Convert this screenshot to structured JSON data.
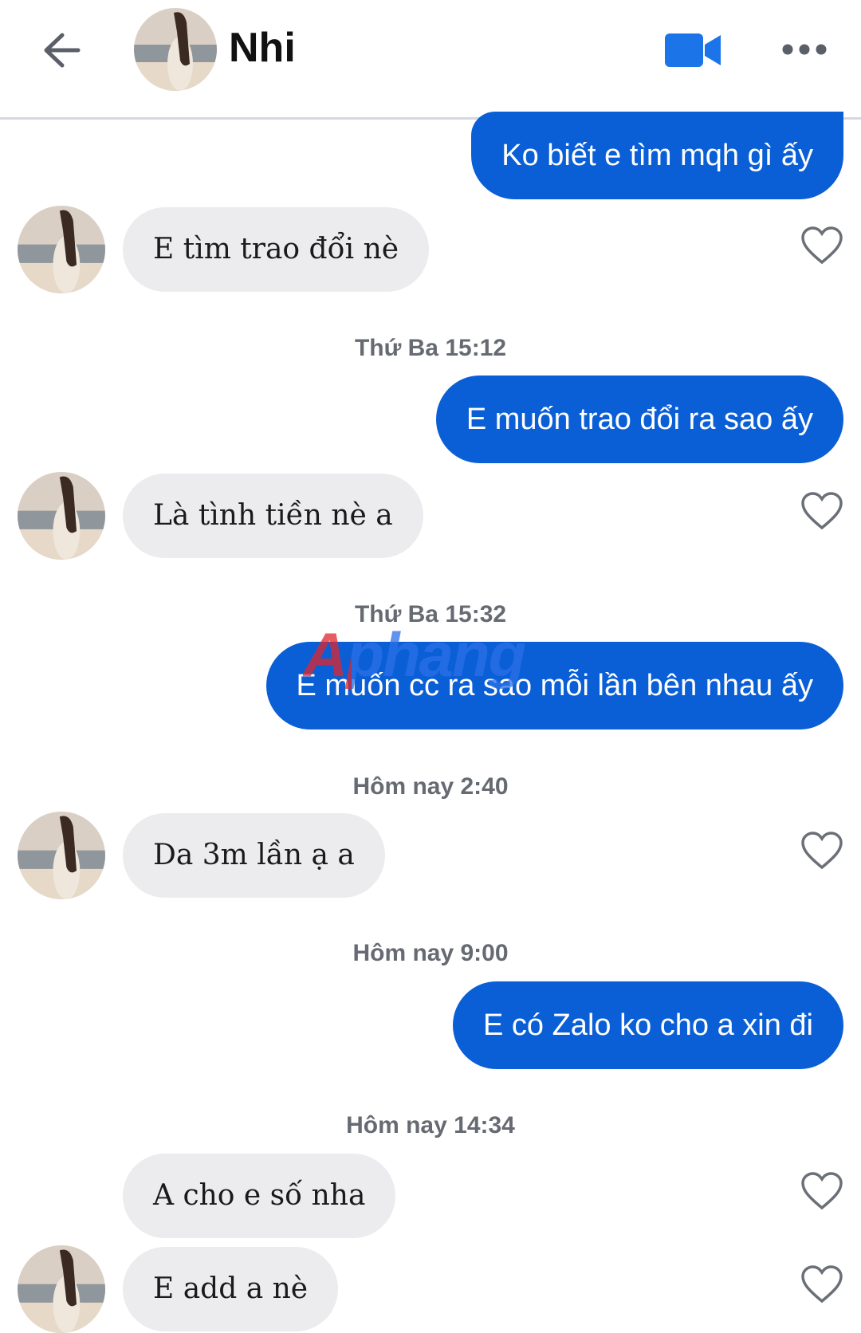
{
  "header": {
    "contact_name": "Nhi",
    "back_icon": "back-arrow-icon",
    "video_icon": "video-call-icon",
    "more_icon": "more-options-icon"
  },
  "colors": {
    "outgoing_bubble": "#0a5fd6",
    "incoming_bubble": "#ececee",
    "timestamp_text": "#666a72"
  },
  "watermark": "Aphang",
  "messages": [
    {
      "dir": "out",
      "text": "Ko biết e tìm mqh gì ấy"
    },
    {
      "dir": "in",
      "text": "E tìm trao đổi nè",
      "liked": false
    },
    {
      "type": "timestamp",
      "text": "Thứ Ba 15:12"
    },
    {
      "dir": "out",
      "text": "E muốn trao đổi ra sao ấy"
    },
    {
      "dir": "in",
      "text": "Là tình tiền nè a",
      "liked": false
    },
    {
      "type": "timestamp",
      "text": "Thứ Ba 15:32"
    },
    {
      "dir": "out",
      "text": "E muốn cc ra sao mỗi lần bên nhau ấy"
    },
    {
      "type": "timestamp",
      "text": "Hôm nay 2:40"
    },
    {
      "dir": "in",
      "text": "Da 3m lần ạ a",
      "liked": false
    },
    {
      "type": "timestamp",
      "text": "Hôm nay 9:00"
    },
    {
      "dir": "out",
      "text": "E có Zalo ko cho a xin đi"
    },
    {
      "type": "timestamp",
      "text": "Hôm nay 14:34"
    },
    {
      "dir": "in",
      "text": "A cho e số nha",
      "liked": false
    },
    {
      "dir": "in",
      "text": "E add a nè",
      "liked": false
    }
  ]
}
